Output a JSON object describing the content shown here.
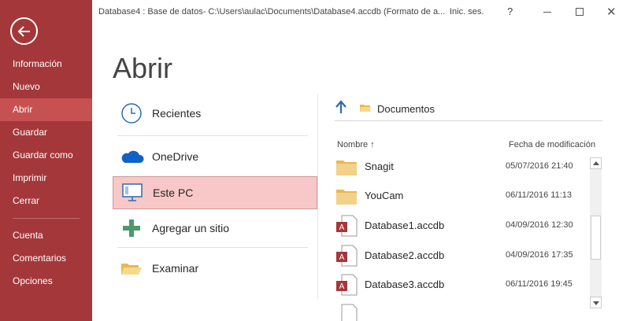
{
  "window": {
    "title": "Database4 : Base de datos- C:\\Users\\aulac\\Documents\\Database4.accdb (Formato de a...",
    "signin_label": "Inic. ses.",
    "help_label": "?",
    "close_glyph": "✕"
  },
  "sidebar": {
    "items": [
      {
        "label": "Información"
      },
      {
        "label": "Nuevo"
      },
      {
        "label": "Abrir",
        "active": true
      },
      {
        "label": "Guardar"
      },
      {
        "label": "Guardar como"
      },
      {
        "label": "Imprimir"
      },
      {
        "label": "Cerrar"
      },
      {
        "label": "Cuenta"
      },
      {
        "label": "Comentarios"
      },
      {
        "label": "Opciones"
      }
    ]
  },
  "page": {
    "title": "Abrir"
  },
  "locations": [
    {
      "label": "Recientes",
      "icon": "clock-icon"
    },
    {
      "label": "OneDrive",
      "icon": "cloud-icon"
    },
    {
      "label": "Este PC",
      "icon": "computer-icon",
      "active": true
    },
    {
      "label": "Agregar un sitio",
      "icon": "plus-icon"
    },
    {
      "label": "Examinar",
      "icon": "folder-open-icon"
    }
  ],
  "browser": {
    "current_folder": "Documentos",
    "columns": {
      "name": "Nombre ↑",
      "date": "Fecha de modificación"
    },
    "files": [
      {
        "name": "Snagit",
        "date": "05/07/2016 21:40",
        "type": "folder"
      },
      {
        "name": "YouCam",
        "date": "06/11/2016 11:13",
        "type": "folder"
      },
      {
        "name": "Database1.accdb",
        "date": "04/09/2016 12:30",
        "type": "access"
      },
      {
        "name": "Database2.accdb",
        "date": "04/09/2016 17:35",
        "type": "access"
      },
      {
        "name": "Database3.accdb",
        "date": "06/11/2016 19:45",
        "type": "access"
      }
    ]
  },
  "colors": {
    "sidebar_bg": "#a4373a",
    "sidebar_active": "#c75050",
    "selected_location": "#f8c7c7",
    "access_red": "#a4373a",
    "folder_yellow": "#f2d188",
    "onedrive_blue": "#0f63c6",
    "plus_green": "#4a9a6c"
  }
}
